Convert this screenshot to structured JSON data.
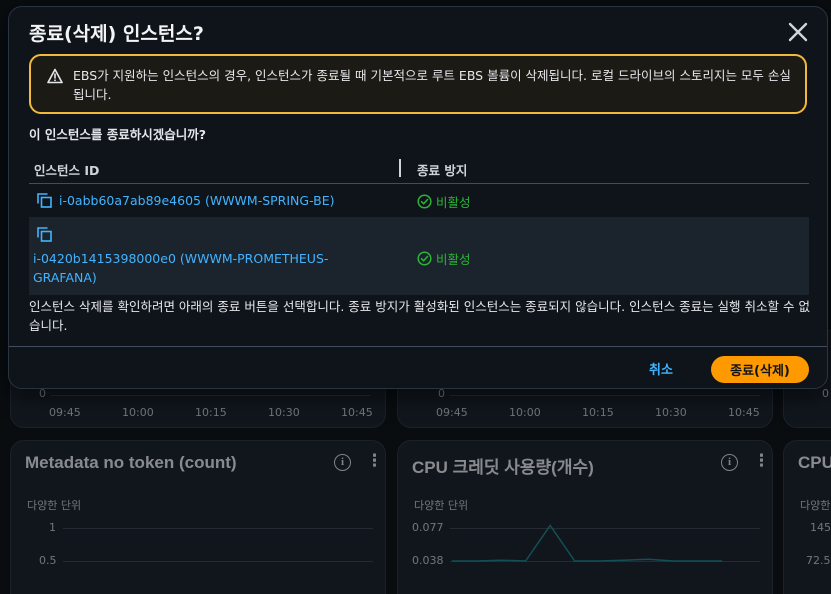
{
  "modal": {
    "title": "종료(삭제) 인스턴스?",
    "warning": "EBS가 지원하는 인스턴스의 경우, 인스턴스가 종료될 때 기본적으로 루트 EBS 볼륨이 삭제됩니다. 로컬 드라이브의 스토리지는 모두 손실됩니다.",
    "question": "이 인스턴스를 종료하시겠습니까?",
    "table": {
      "headers": [
        "인스턴스 ID",
        "종료 방지"
      ],
      "rows": [
        {
          "instance": "i-0abb60a7ab89e4605 (WWWM-SPRING-BE)",
          "protection": "비활성"
        },
        {
          "instance": "i-0420b1415398000e0 (WWWM-PROMETHEUS-GRAFANA)",
          "protection": "비활성"
        }
      ]
    },
    "note": "인스턴스 삭제를 확인하려면 아래의 종료 버튼을 선택합니다. 종료 방지가 활성화된 인스턴스는 종료되지 않습니다. 인스턴스 종료는 실행 취소할 수 없습니다.",
    "cancel_label": "취소",
    "terminate_label": "종료(삭제)"
  },
  "colors": {
    "accent": "#ff9900",
    "link": "#42b4ff",
    "warning_border": "#f2b93b",
    "success": "#2bb534"
  },
  "background": {
    "top_cards": [
      {
        "y_tick": "0",
        "x_ticks": [
          "09:45",
          "10:00",
          "10:15",
          "10:30",
          "10:45"
        ]
      },
      {
        "y_tick": "0",
        "x_ticks": [
          "09:45",
          "10:00",
          "10:15",
          "10:30",
          "10:45"
        ]
      },
      {
        "y_tick": "0",
        "x_ticks": []
      }
    ],
    "cards": [
      {
        "title": "Metadata no token (count)",
        "unit": "다양한 단위",
        "y_ticks": [
          "1",
          "0.5"
        ]
      },
      {
        "title": "CPU 크레딧 사용량(개수)",
        "unit": "다양한 단위",
        "y_ticks": [
          "0.077",
          "0.038"
        ]
      },
      {
        "title": "CPU",
        "unit": "다양한",
        "y_ticks": [
          "145",
          "72.5"
        ]
      }
    ]
  },
  "chart_data": {
    "type": "line",
    "title": "CPU 크레딧 사용량(개수)",
    "ylabel": "다양한 단위",
    "y_ticks": [
      0.077,
      0.038
    ],
    "series": [
      {
        "values": [
          0.038,
          0.038,
          0.039,
          0.038,
          0.08,
          0.038,
          0.038,
          0.039,
          0.04,
          0.038,
          0.038,
          0.038
        ]
      }
    ]
  }
}
